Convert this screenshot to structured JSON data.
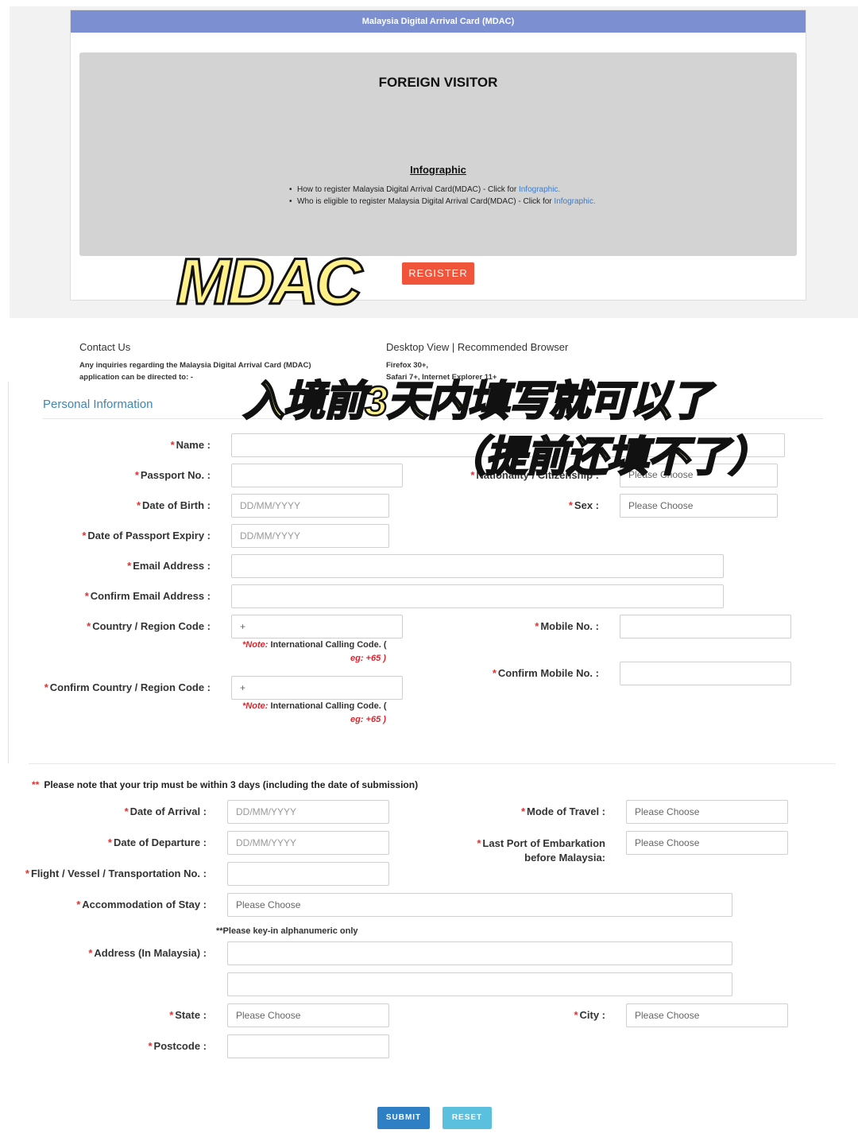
{
  "header": {
    "title": "Malaysia Digital Arrival Card (MDAC)"
  },
  "landing": {
    "heading": "FOREIGN VISITOR",
    "infographic_title": "Infographic",
    "items": [
      {
        "text": "How to register Malaysia Digital Arrival Card(MDAC) - Click for ",
        "link": "Infographic."
      },
      {
        "text": "Who is eligible to register Malaysia Digital Arrival Card(MDAC) - Click for ",
        "link": "Infographic."
      }
    ],
    "register_label": "REGISTER"
  },
  "overlays": {
    "mdac": "MDAC",
    "line1": "入境前3天内填写就可以了",
    "line2": "（提前还填不了）"
  },
  "footer": {
    "contact_title": "Contact Us",
    "contact_text": "Any inquiries regarding the Malaysia Digital Arrival Card (MDAC) application can be directed to: -",
    "desktop_title": "Desktop View | Recommended Browser",
    "browser_1": "Firefox 30+,",
    "browser_2": "Safari 7+, Internet Explorer 11+"
  },
  "personal": {
    "section_title": "Personal Information",
    "name_label": "Name :",
    "passport_label": "Passport No. :",
    "nationality_label": "Nationality / Citizenship :",
    "nationality_value": "Please Choose",
    "dob_label": "Date of Birth :",
    "dob_placeholder": "DD/MM/YYYY",
    "sex_label": "Sex :",
    "sex_value": "Please Choose",
    "expiry_label": "Date of Passport Expiry :",
    "expiry_placeholder": "DD/MM/YYYY",
    "email_label": "Email Address :",
    "confirm_email_label": "Confirm Email Address :",
    "country_code_label": "Country / Region Code :",
    "country_code_value": "+",
    "mobile_label": "Mobile No. :",
    "note_prefix": "*Note:",
    "note_text": " International Calling Code. (",
    "note_eg": "eg: +65 )",
    "confirm_mobile_label": "Confirm Mobile No. :",
    "confirm_country_code_label": "Confirm Country / Region Code :",
    "confirm_country_code_value": "+"
  },
  "trip": {
    "asterisks": "**",
    "note": "Please note that your trip must be within 3 days (including the date of submission)",
    "arrival_label": "Date of Arrival :",
    "arrival_placeholder": "DD/MM/YYYY",
    "mode_label": "Mode of Travel :",
    "mode_value": "Please Choose",
    "departure_label": "Date of Departure :",
    "departure_placeholder": "DD/MM/YYYY",
    "last_port_label_1": "Last Port of Embarkation",
    "last_port_label_2": "before Malaysia:",
    "last_port_value": "Please Choose",
    "flight_label": "Flight / Vessel / Transportation No. :",
    "accommodation_label": "Accommodation of Stay :",
    "accommodation_value": "Please Choose",
    "alnum_note": "**Please key-in alphanumeric only",
    "address_label": "Address (In Malaysia) :",
    "state_label": "State :",
    "state_value": "Please Choose",
    "city_label": "City :",
    "city_value": "Please Choose",
    "postcode_label": "Postcode :",
    "submit_label": "SUBMIT",
    "reset_label": "RESET"
  }
}
